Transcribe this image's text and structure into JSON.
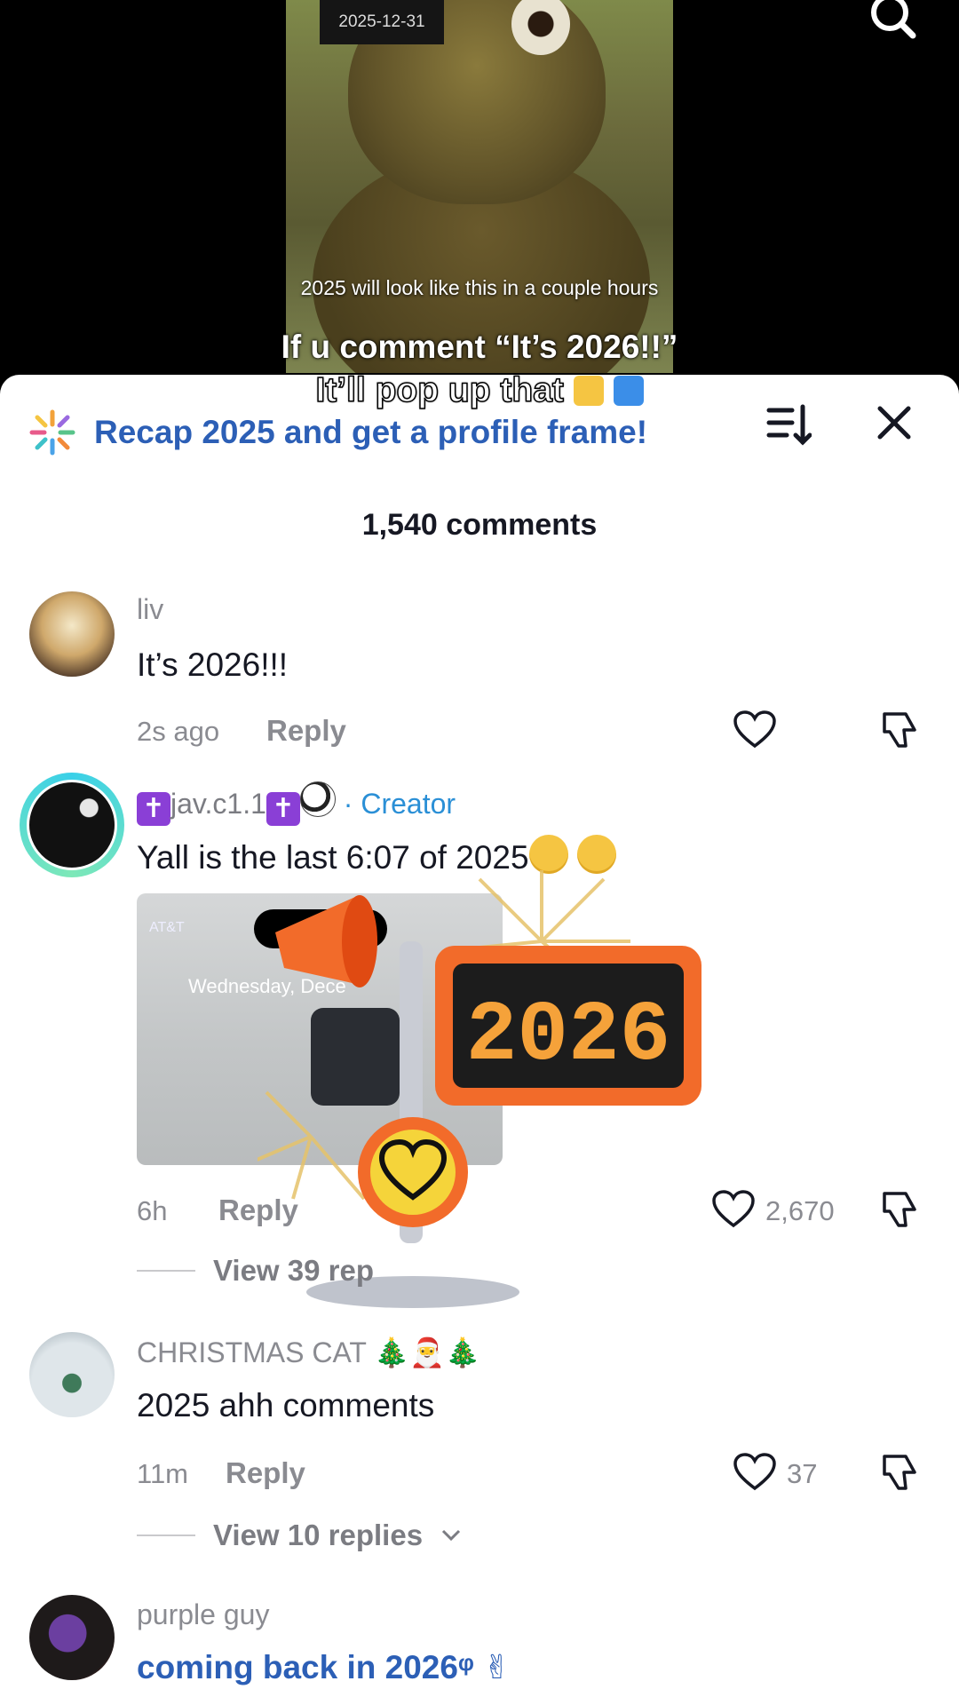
{
  "video": {
    "date_badge": "2025-12-31",
    "caption": "2025 will look like this in a couple hours",
    "overlay_line1": "If u comment “It’s 2026!!”",
    "overlay_line2": "It’ll pop up that"
  },
  "sheet": {
    "recap_text": "Recap 2025 and get a profile frame!",
    "comment_count": "1,540 comments"
  },
  "comments": [
    {
      "name": "liv",
      "text": "It’s 2026!!!",
      "time": "2s ago",
      "reply": "Reply",
      "likes": ""
    },
    {
      "name": "jav.c1.1",
      "role": "· Creator",
      "text": "Yall is the last 6:07 of 2025",
      "time": "6h",
      "reply": "Reply",
      "likes": "2,670",
      "view_replies": "View 39 rep"
    },
    {
      "name": "CHRISTMAS CAT",
      "name_emoji": "🎄🎅🎄",
      "text": "2025 ahh comments",
      "time": "11m",
      "reply": "Reply",
      "likes": "37",
      "view_replies": "View 10 replies"
    },
    {
      "name": "purple guy",
      "text": "coming back in 2026",
      "text_suffix": "ᵠ ✌"
    }
  ],
  "screenshot": {
    "carrier": "AT&T",
    "date": "Wednesday, Dece"
  },
  "sticker": {
    "sign_text": "2026"
  },
  "icons": [
    "search-icon",
    "sparkle-icon",
    "sort-icon",
    "close-icon",
    "heart-icon",
    "dislike-icon",
    "chevron-down-icon"
  ],
  "colors": {
    "accent_blue": "#2c5fb6",
    "creator_blue": "#2a8fd6",
    "muted": "#8a8b91"
  }
}
